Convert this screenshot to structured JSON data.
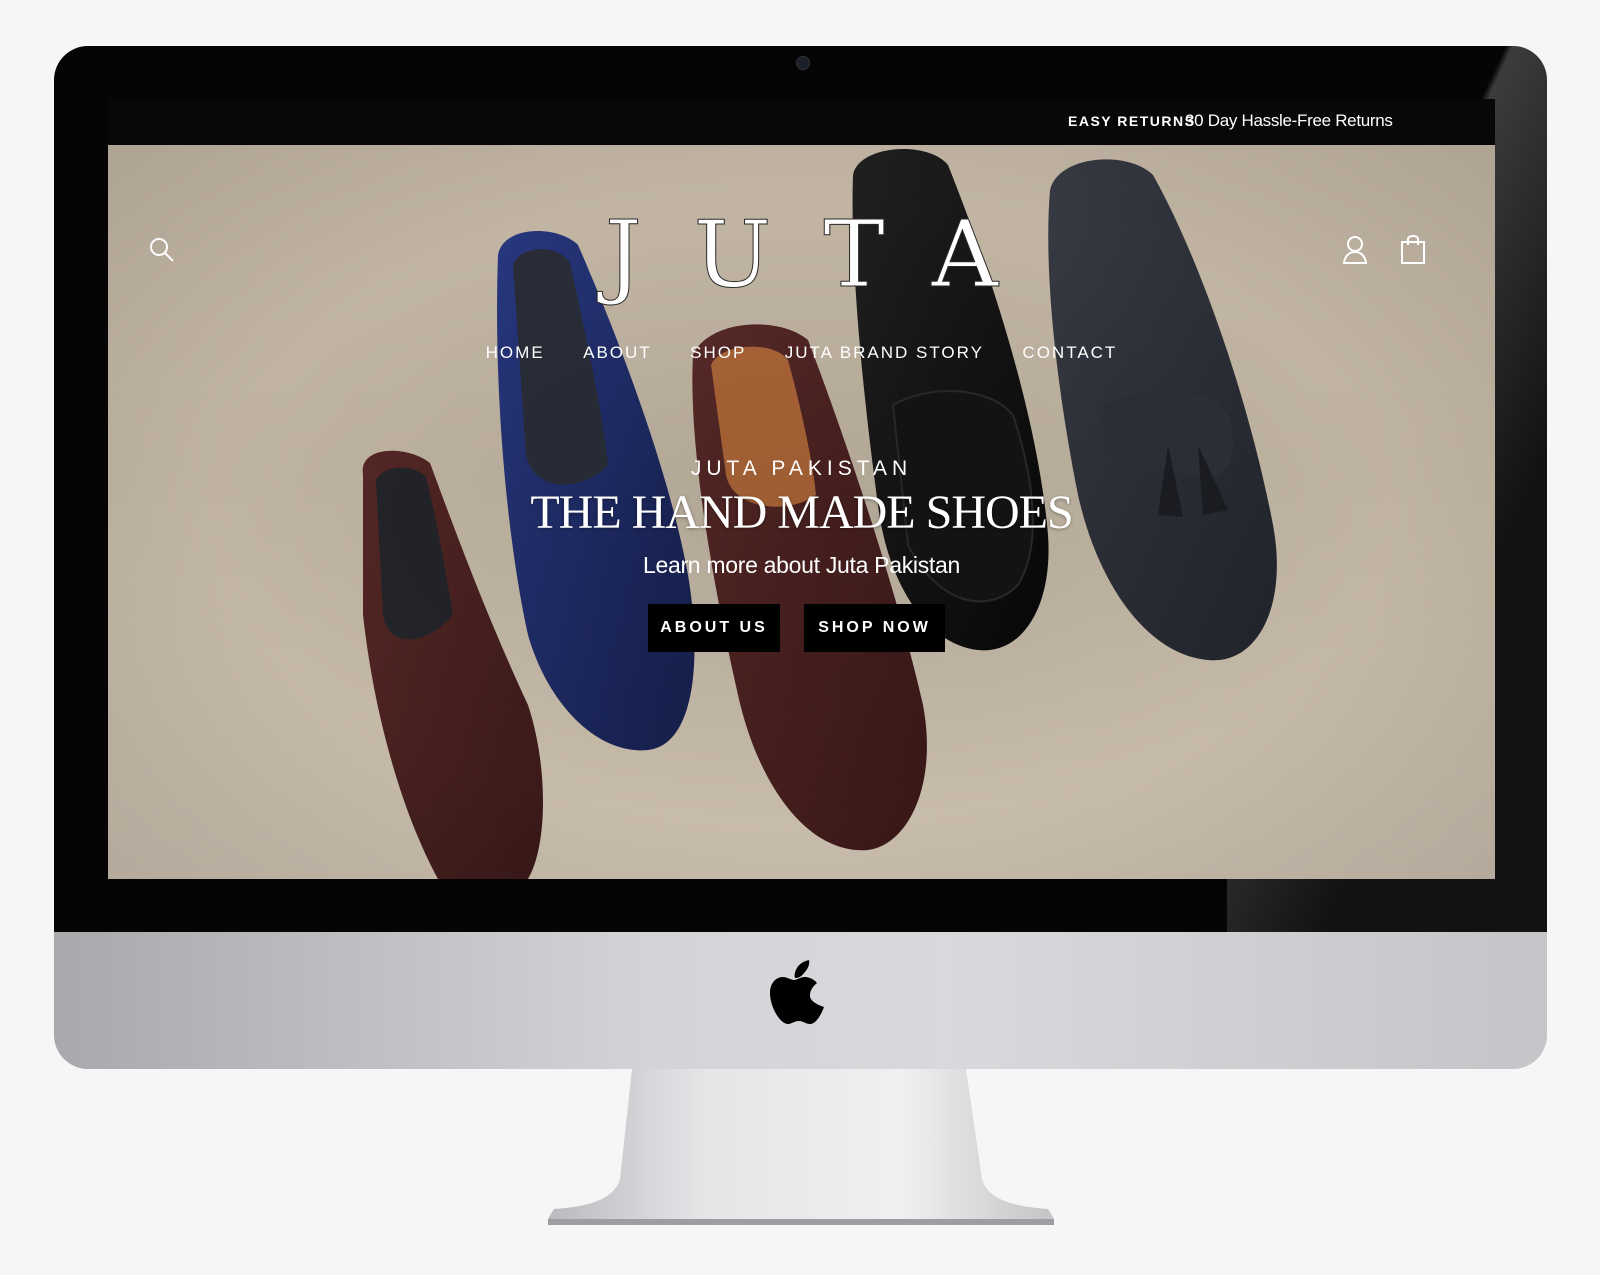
{
  "announcement": {
    "label": "EASY RETURNS",
    "text": "30 Day Hassle-Free Returns"
  },
  "header": {
    "logo": "JUTA",
    "icons": {
      "search": "search-icon",
      "account": "account-icon",
      "cart": "cart-icon"
    }
  },
  "nav": {
    "items": [
      {
        "label": "HOME"
      },
      {
        "label": "ABOUT"
      },
      {
        "label": "SHOP"
      },
      {
        "label": "JUTA BRAND STORY"
      },
      {
        "label": "CONTACT"
      }
    ]
  },
  "hero": {
    "eyebrow": "JUTA PAKISTAN",
    "title": "THE HAND MADE SHOES",
    "subtitle": "Learn more about Juta Pakistan",
    "buttons": {
      "about": "ABOUT US",
      "shop": "SHOP NOW"
    }
  },
  "device": {
    "logo": "apple-logo-icon"
  },
  "colors": {
    "bar": "#080808",
    "hero_bg": "#cdbfad",
    "button": "#000000",
    "text": "#ffffff"
  }
}
